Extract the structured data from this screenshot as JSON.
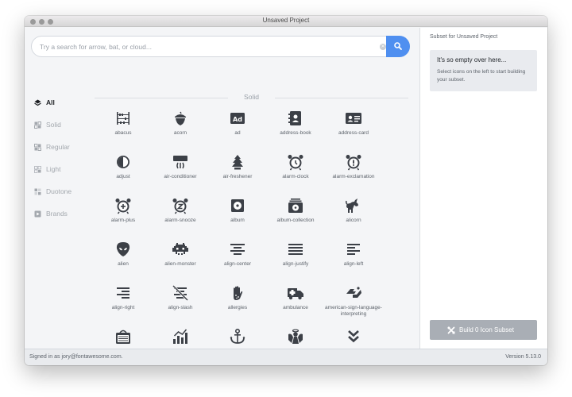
{
  "window": {
    "title": "Unsaved Project"
  },
  "search": {
    "placeholder": "Try a search for arrow, bat, or cloud..."
  },
  "styles": [
    {
      "label": "All",
      "icon": "layer-group-icon",
      "active": true
    },
    {
      "label": "Solid",
      "icon": "solid-style-icon",
      "active": false
    },
    {
      "label": "Regular",
      "icon": "regular-style-icon",
      "active": false
    },
    {
      "label": "Light",
      "icon": "light-style-icon",
      "active": false
    },
    {
      "label": "Duotone",
      "icon": "duotone-style-icon",
      "active": false
    },
    {
      "label": "Brands",
      "icon": "brands-style-icon",
      "active": false
    }
  ],
  "section": {
    "title": "Solid"
  },
  "icons": [
    {
      "name": "abacus"
    },
    {
      "name": "acorn"
    },
    {
      "name": "ad"
    },
    {
      "name": "address-book"
    },
    {
      "name": "address-card"
    },
    {
      "name": "adjust"
    },
    {
      "name": "air-conditioner"
    },
    {
      "name": "air-freshener"
    },
    {
      "name": "alarm-clock"
    },
    {
      "name": "alarm-exclamation"
    },
    {
      "name": "alarm-plus"
    },
    {
      "name": "alarm-snooze"
    },
    {
      "name": "album"
    },
    {
      "name": "album-collection"
    },
    {
      "name": "alicorn"
    },
    {
      "name": "alien"
    },
    {
      "name": "alien-monster"
    },
    {
      "name": "align-center"
    },
    {
      "name": "align-justify"
    },
    {
      "name": "align-left"
    },
    {
      "name": "align-right"
    },
    {
      "name": "align-slash"
    },
    {
      "name": "allergies"
    },
    {
      "name": "ambulance"
    },
    {
      "name": "american-sign-language-interpreting"
    },
    {
      "name": "amp-guitar"
    },
    {
      "name": "analytics"
    },
    {
      "name": "anchor"
    },
    {
      "name": "angel"
    },
    {
      "name": "angle-double-down"
    }
  ],
  "sidebar": {
    "title": "Subset for Unsaved Project",
    "empty_title": "It's so empty over here...",
    "empty_text": "Select icons on the left to start building your subset.",
    "build_label": "Build 0 Icon Subset"
  },
  "status": {
    "signed_in": "Signed in as jory@fontawesome.com.",
    "version": "Version 5.13.0"
  },
  "colors": {
    "accent": "#4f8ff0",
    "icon": "#3c4047",
    "muted": "#a3a8ae",
    "disabled_button": "#a9aeb5"
  }
}
